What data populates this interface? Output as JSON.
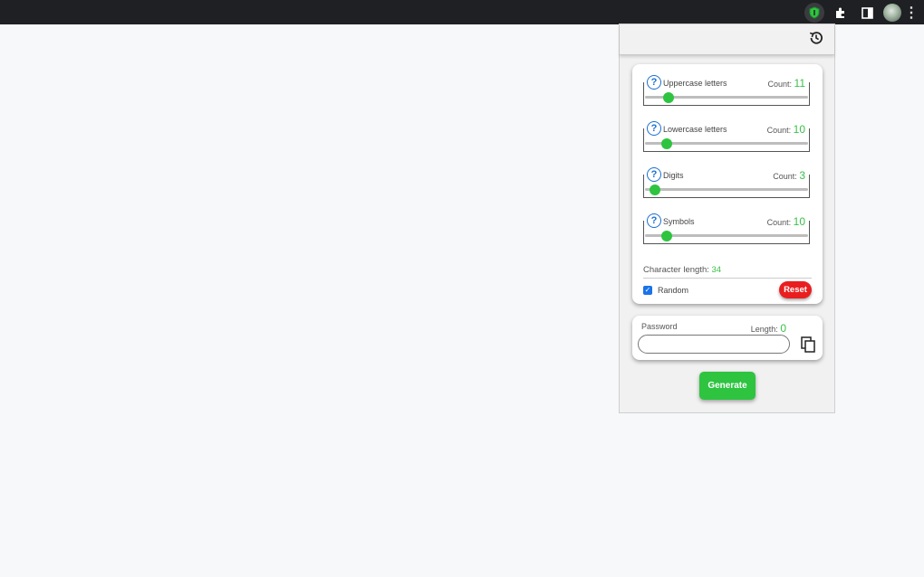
{
  "browser": {
    "toolbar_icons": [
      "shield-extension-icon",
      "puzzle-extensions-icon",
      "side-panel-icon",
      "profile-avatar-icon",
      "kebab-menu-icon"
    ]
  },
  "popup": {
    "history_icon": "history-icon",
    "options": [
      {
        "label": "Uppercase letters",
        "count_label": "Count:",
        "count": "11",
        "level": 0.11
      },
      {
        "label": "Lowercase letters",
        "count_label": "Count:",
        "count": "10",
        "level": 0.1
      },
      {
        "label": "Digits",
        "count_label": "Count:",
        "count": "3",
        "level": 0.03
      },
      {
        "label": "Symbols",
        "count_label": "Count:",
        "count": "10",
        "level": 0.1
      }
    ],
    "char_length_label": "Character length:",
    "char_length": "34",
    "random_label": "Random",
    "random_checked": true,
    "reset_label": "Reset",
    "password_label": "Password",
    "length_label": "Length:",
    "length": "0",
    "password_value": "",
    "generate_label": "Generate"
  },
  "colors": {
    "accent_green": "#2ec440",
    "reset_red": "#e91f1f",
    "help_blue": "#1a6fd1"
  }
}
